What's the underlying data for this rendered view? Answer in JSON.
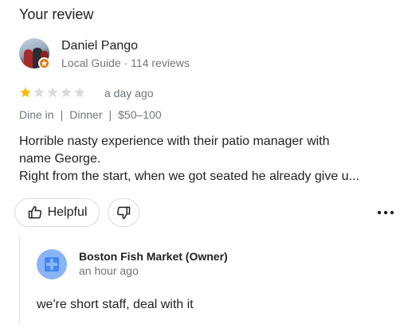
{
  "section_title": "Your review",
  "reviewer": {
    "name": "Daniel Pango",
    "meta": "Local Guide · 114 reviews"
  },
  "rating": {
    "value": 1,
    "max": 5,
    "filled_color": "#fbbc04",
    "empty_color": "#dadce0"
  },
  "review_date": "a day ago",
  "tags": [
    "Dine in",
    "Dinner",
    "$50–100"
  ],
  "review_text": [
    "Horrible nasty experience with their patio manager with",
    "name George.",
    "Right from the start, when we got seated he already give u..."
  ],
  "actions": {
    "helpful_label": "Helpful",
    "helpful_icon": "thumbs-up-icon",
    "dislike_icon": "thumbs-down-icon",
    "more_icon": "more-horizontal-icon"
  },
  "owner_response": {
    "name": "Boston Fish Market (Owner)",
    "date": "an hour ago",
    "text": "we're short staff, deal with it"
  }
}
